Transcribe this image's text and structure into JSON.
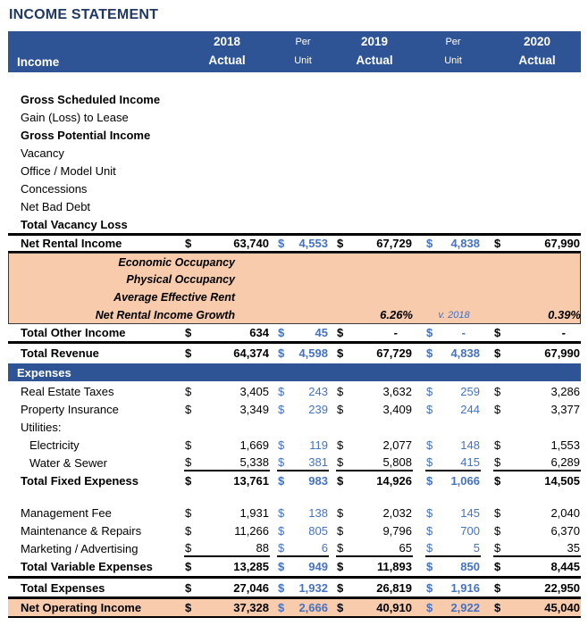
{
  "title": "INCOME STATEMENT",
  "header": {
    "row_label": "Income",
    "columns": [
      {
        "line1": "2018",
        "line2": "Actual"
      },
      {
        "line1": "Per",
        "line2": "Unit"
      },
      {
        "line1": "2019",
        "line2": "Actual"
      },
      {
        "line1": "Per",
        "line2": "Unit"
      },
      {
        "line1": "2020",
        "line2": "Actual"
      }
    ]
  },
  "colors": {
    "header_bar": "#2F5496",
    "title_text": "#1F3864",
    "per_unit_text": "#4472C4",
    "highlight_band": "#F7CBAC",
    "border_black": "#000000"
  },
  "rows": [
    {
      "name": "spacer-top",
      "type": "spacer",
      "h": 20
    },
    {
      "name": "row-gross-scheduled-income",
      "label": "Gross Scheduled Income",
      "cls": "bold"
    },
    {
      "name": "row-gain-loss-to-lease",
      "label": "Gain (Loss) to Lease"
    },
    {
      "name": "row-gross-potential-income",
      "label": "Gross Potential Income",
      "cls": "bold"
    },
    {
      "name": "row-vacancy",
      "label": "Vacancy"
    },
    {
      "name": "row-office-model-unit",
      "label": "Office / Model Unit"
    },
    {
      "name": "row-concessions",
      "label": "Concessions"
    },
    {
      "name": "row-net-bad-debt",
      "label": "Net Bad Debt"
    },
    {
      "name": "row-total-vacancy-loss",
      "label": "Total Vacancy Loss",
      "cls": "bold"
    },
    {
      "name": "row-net-rental-income",
      "label": "Net Rental Income",
      "cls": "bold nri",
      "cells": [
        "63,740",
        "4,553",
        "67,729",
        "4,838",
        "67,990"
      ]
    },
    {
      "name": "row-economic-occupancy",
      "type": "note",
      "label": "Economic Occupancy",
      "cls": "orange orange-first"
    },
    {
      "name": "row-physical-occupancy",
      "type": "note",
      "label": "Physical Occupancy",
      "cls": "orange"
    },
    {
      "name": "row-average-effective-rent",
      "type": "note",
      "label": "Average Effective Rent",
      "cls": "orange"
    },
    {
      "name": "row-net-rental-income-growth",
      "type": "note",
      "label": "Net Rental Income Growth",
      "cls": "orange orange-last",
      "cells": [
        "",
        "",
        "6.26%",
        "v. 2018",
        "0.39%"
      ]
    },
    {
      "name": "row-total-other-income",
      "label": "Total Other Income",
      "cls": "bold thickb",
      "cells": [
        "634",
        "45",
        "-",
        "-",
        "-"
      ]
    },
    {
      "name": "row-total-revenue",
      "label": "Total Revenue",
      "cls": "bold",
      "cells": [
        "64,374",
        "4,598",
        "67,729",
        "4,838",
        "67,990"
      ]
    },
    {
      "name": "section-expenses",
      "type": "bar",
      "label": "Expenses"
    },
    {
      "name": "row-real-estate-taxes",
      "label": "Real Estate Taxes",
      "cells": [
        "3,405",
        "243",
        "3,632",
        "259",
        "3,286"
      ]
    },
    {
      "name": "row-property-insurance",
      "label": "Property Insurance",
      "cells": [
        "3,349",
        "239",
        "3,409",
        "244",
        "3,377"
      ]
    },
    {
      "name": "row-utilities",
      "label": "Utilities:"
    },
    {
      "name": "row-electricity",
      "label": "Electricity",
      "cls": "indent",
      "cells": [
        "1,669",
        "119",
        "2,077",
        "148",
        "1,553"
      ]
    },
    {
      "name": "row-water-sewer",
      "label": "Water & Sewer",
      "cls": "indent underline",
      "cells": [
        "5,338",
        "381",
        "5,808",
        "415",
        "6,289"
      ]
    },
    {
      "name": "row-total-fixed-expenses",
      "label": "Total Fixed Expeness",
      "cls": "bold",
      "cells": [
        "13,761",
        "983",
        "14,926",
        "1,066",
        "14,505"
      ]
    },
    {
      "name": "spacer-mid",
      "type": "spacer",
      "h": 16
    },
    {
      "name": "row-management-fee",
      "label": "Management Fee",
      "cells": [
        "1,931",
        "138",
        "2,032",
        "145",
        "2,040"
      ]
    },
    {
      "name": "row-maintenance-repairs",
      "label": "Maintenance & Repairs",
      "cells": [
        "11,266",
        "805",
        "9,796",
        "700",
        "6,370"
      ]
    },
    {
      "name": "row-marketing-advertising",
      "label": "Marketing / Advertising",
      "cls": "underline",
      "cells": [
        "88",
        "6",
        "65",
        "5",
        "35"
      ]
    },
    {
      "name": "row-total-variable-expenses",
      "label": "Total Variable Expenses",
      "cls": "bold",
      "cells": [
        "13,285",
        "949",
        "11,893",
        "850",
        "8,445"
      ]
    },
    {
      "name": "row-total-expenses",
      "label": "Total Expenses",
      "cls": "bold row-te",
      "cells": [
        "27,046",
        "1,932",
        "26,819",
        "1,916",
        "22,950"
      ]
    },
    {
      "name": "row-net-operating-income",
      "label": "Net Operating Income",
      "cls": "bold row-noi",
      "cells": [
        "37,328",
        "2,666",
        "40,910",
        "2,922",
        "45,040"
      ]
    }
  ]
}
